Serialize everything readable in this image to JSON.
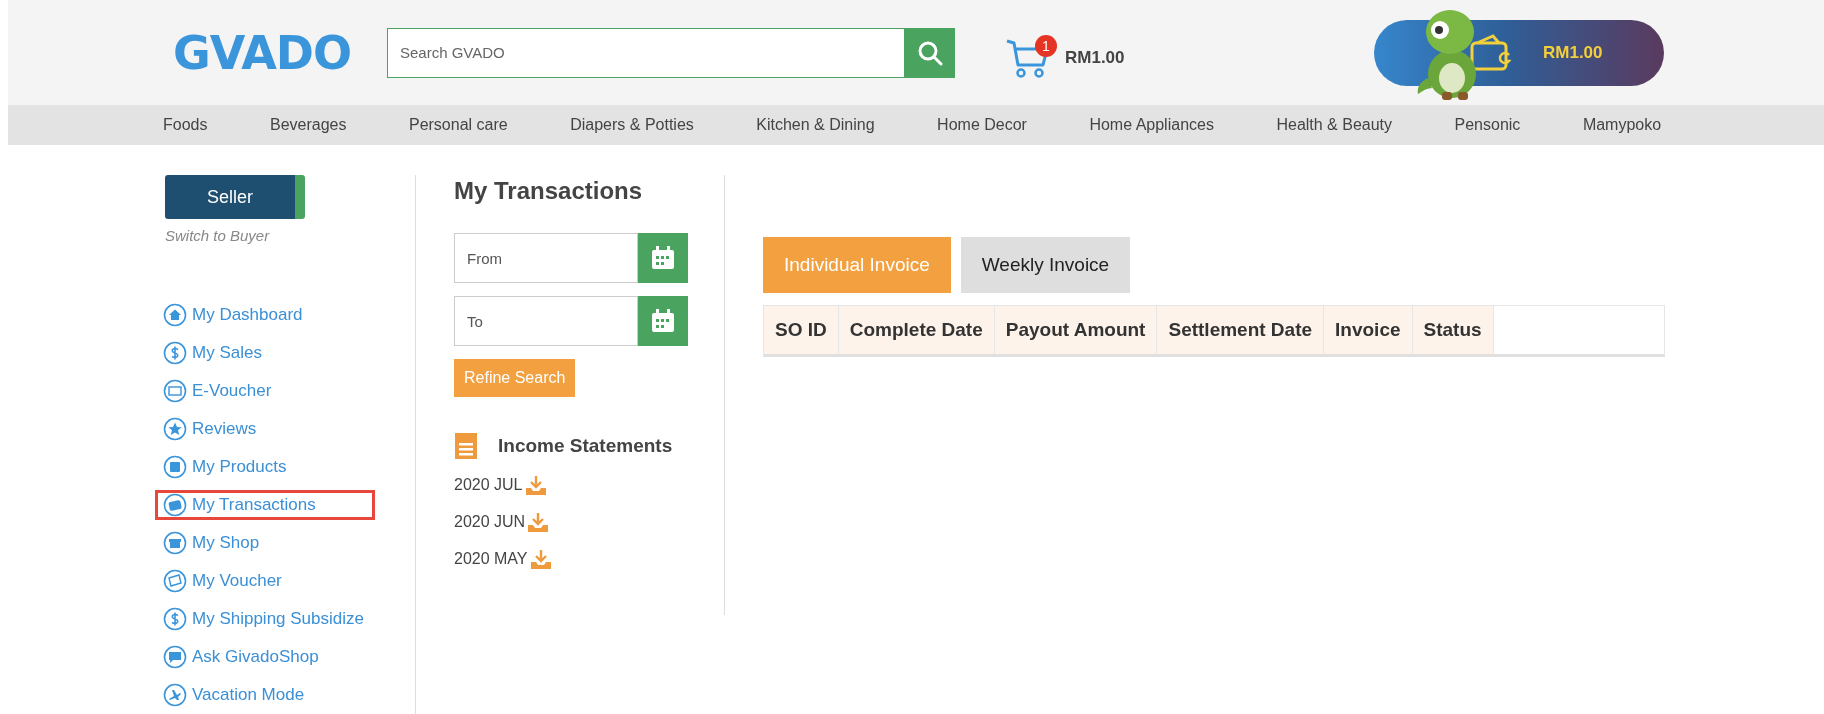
{
  "header": {
    "logo": "GVADO",
    "search": {
      "placeholder": "Search GVADO"
    },
    "cart": {
      "count": "1",
      "total": "RM1.00"
    },
    "wallet": {
      "balance": "RM1.00"
    }
  },
  "nav": [
    "Foods",
    "Beverages",
    "Personal care",
    "Diapers & Potties",
    "Kitchen & Dining",
    "Home Decor",
    "Home Appliances",
    "Health & Beauty",
    "Pensonic",
    "Mamypoko"
  ],
  "sidebar": {
    "mode_button": "Seller",
    "switch_link": "Switch to Buyer",
    "items": [
      {
        "label": "My Dashboard",
        "kind": "home",
        "selected": false
      },
      {
        "label": "My Sales",
        "kind": "money",
        "selected": false
      },
      {
        "label": "E-Voucher",
        "kind": "ticket",
        "selected": false
      },
      {
        "label": "Reviews",
        "kind": "star",
        "selected": false
      },
      {
        "label": "My Products",
        "kind": "grid",
        "selected": false
      },
      {
        "label": "My Transactions",
        "kind": "wallet",
        "selected": true
      },
      {
        "label": "My Shop",
        "kind": "shop",
        "selected": false
      },
      {
        "label": "My Voucher",
        "kind": "percent",
        "selected": false
      },
      {
        "label": "My Shipping Subsidize",
        "kind": "money",
        "selected": false
      },
      {
        "label": "Ask GivadoShop",
        "kind": "chat",
        "selected": false
      },
      {
        "label": "Vacation Mode",
        "kind": "plane",
        "selected": false
      }
    ]
  },
  "page_title": "My Transactions",
  "filters": {
    "from": {
      "placeholder": "From"
    },
    "to": {
      "placeholder": "To"
    },
    "refine_button": "Refine Search"
  },
  "income_statements": {
    "title": "Income Statements",
    "items": [
      "2020 JUL",
      "2020 JUN",
      "2020 MAY"
    ]
  },
  "tabs": [
    {
      "label": "Individual Invoice",
      "selected": true
    },
    {
      "label": "Weekly Invoice",
      "selected": false
    }
  ],
  "table": {
    "columns": [
      "SO ID",
      "Complete Date",
      "Payout Amount",
      "Settlement Date",
      "Invoice",
      "Status"
    ]
  }
}
